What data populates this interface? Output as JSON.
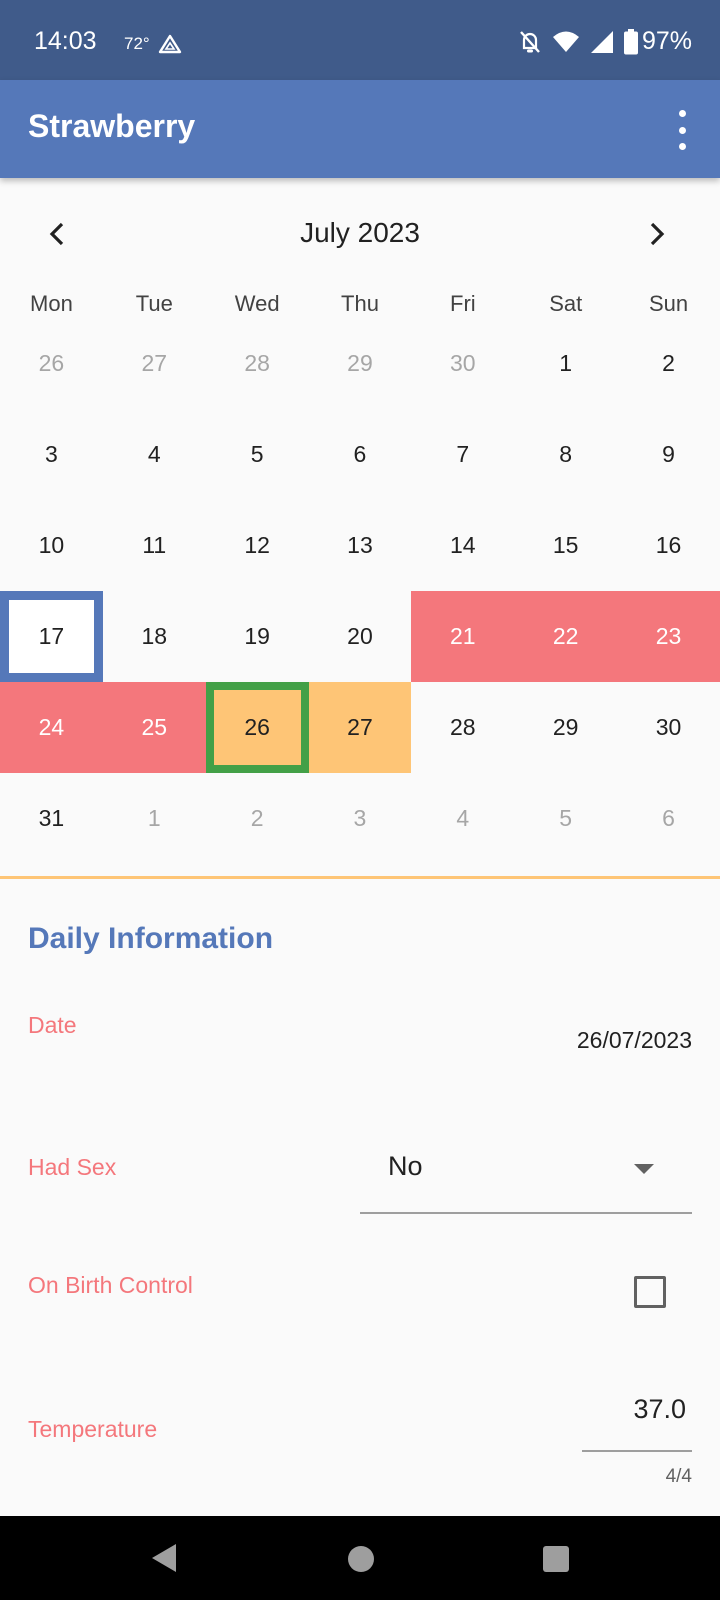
{
  "status_bar": {
    "time": "14:03",
    "temperature": "72°",
    "battery": "97%",
    "icons": [
      "drive-icon",
      "bell-off-icon",
      "wifi-icon",
      "signal-icon",
      "battery-icon"
    ]
  },
  "app_bar": {
    "title": "Strawberry",
    "menu_icon": "more-vert-icon"
  },
  "calendar": {
    "month_label": "July 2023",
    "weekdays": [
      "Mon",
      "Tue",
      "Wed",
      "Thu",
      "Fri",
      "Sat",
      "Sun"
    ],
    "weeks": [
      [
        {
          "d": "26",
          "m": true
        },
        {
          "d": "27",
          "m": true
        },
        {
          "d": "28",
          "m": true
        },
        {
          "d": "29",
          "m": true
        },
        {
          "d": "30",
          "m": true
        },
        {
          "d": "1"
        },
        {
          "d": "2"
        }
      ],
      [
        {
          "d": "3"
        },
        {
          "d": "4"
        },
        {
          "d": "5"
        },
        {
          "d": "6"
        },
        {
          "d": "7"
        },
        {
          "d": "8"
        },
        {
          "d": "9"
        }
      ],
      [
        {
          "d": "10"
        },
        {
          "d": "11"
        },
        {
          "d": "12"
        },
        {
          "d": "13"
        },
        {
          "d": "14"
        },
        {
          "d": "15"
        },
        {
          "d": "16"
        }
      ],
      [
        {
          "d": "17",
          "today": true
        },
        {
          "d": "18"
        },
        {
          "d": "19"
        },
        {
          "d": "20"
        },
        {
          "d": "21",
          "state": "period"
        },
        {
          "d": "22",
          "state": "period"
        },
        {
          "d": "23",
          "state": "period"
        }
      ],
      [
        {
          "d": "24",
          "state": "period"
        },
        {
          "d": "25",
          "state": "period"
        },
        {
          "d": "26",
          "state": "fertile",
          "selected": true
        },
        {
          "d": "27",
          "state": "fertile"
        },
        {
          "d": "28"
        },
        {
          "d": "29"
        },
        {
          "d": "30"
        }
      ],
      [
        {
          "d": "31"
        },
        {
          "d": "1",
          "m": true
        },
        {
          "d": "2",
          "m": true
        },
        {
          "d": "3",
          "m": true
        },
        {
          "d": "4",
          "m": true
        },
        {
          "d": "5",
          "m": true
        },
        {
          "d": "6",
          "m": true
        }
      ]
    ],
    "colors": {
      "period": "#f4777c",
      "fertile": "#fec576",
      "today_border": "#5578b9",
      "selected_border": "#43a047"
    }
  },
  "daily_info": {
    "section_title": "Daily Information",
    "date_label": "Date",
    "date_value": "26/07/2023",
    "had_sex_label": "Had Sex",
    "had_sex_value": "No",
    "birth_control_label": "On Birth Control",
    "birth_control_checked": false,
    "temperature_label": "Temperature",
    "temperature_value": "37.0",
    "temperature_counter": "4/4"
  },
  "colors": {
    "status_bar": "#405b8a",
    "app_bar": "#5578b9",
    "accent_label": "#f4777c",
    "section_title": "#5578b9"
  }
}
